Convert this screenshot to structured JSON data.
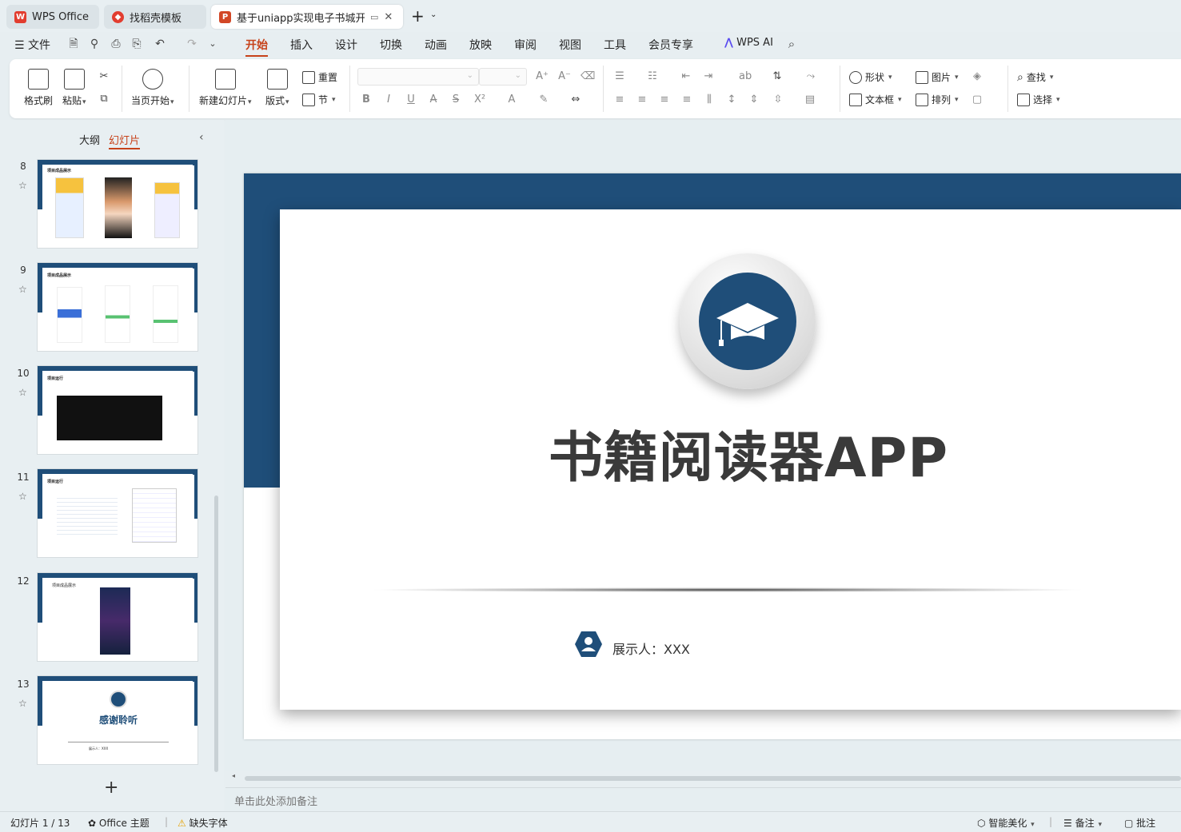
{
  "tabs": [
    {
      "label": "WPS Office",
      "icon": "wps-logo-icon"
    },
    {
      "label": "找稻壳模板",
      "icon": "docer-icon"
    },
    {
      "label": "基于uniapp实现电子书城开发",
      "icon": "ppt-file-icon"
    }
  ],
  "new_tab_symbol": "+",
  "menu": {
    "file": "文件",
    "items": [
      "开始",
      "插入",
      "设计",
      "切换",
      "动画",
      "放映",
      "审阅",
      "视图",
      "工具",
      "会员专享"
    ],
    "active_index": 0,
    "wps_ai": "WPS AI"
  },
  "ribbon": {
    "format_painter": "格式刷",
    "paste": "粘贴",
    "start_from_current": "当页开始",
    "new_slide": "新建幻灯片",
    "layout": "版式",
    "reset": "重置",
    "section": "节",
    "shape": "形状",
    "picture": "图片",
    "textbox": "文本框",
    "arrange": "排列",
    "find": "查找",
    "select": "选择"
  },
  "left_panel": {
    "tab_outline": "大纲",
    "tab_slides": "幻灯片",
    "active_tab": "幻灯片",
    "slides": [
      {
        "number": "8",
        "title": "项目成品展示"
      },
      {
        "number": "9",
        "title": "项目成品展示"
      },
      {
        "number": "10",
        "title": "项目运行"
      },
      {
        "number": "11",
        "title": "项目运行"
      },
      {
        "number": "12",
        "title": "项目成品展示"
      },
      {
        "number": "13",
        "title": "感谢聆听",
        "presenter": "展示人：XXX"
      }
    ],
    "add_slide_symbol": "+"
  },
  "slide": {
    "title": "书籍阅读器APP",
    "presenter": "展示人：XXX",
    "accent_color": "#1f4e79"
  },
  "notes_placeholder": "单击此处添加备注",
  "status": {
    "slide_indicator": "幻灯片 1 / 13",
    "theme": "Office 主题",
    "missing_fonts": "缺失字体",
    "beautify": "智能美化",
    "notes": "备注",
    "comments": "批注"
  }
}
